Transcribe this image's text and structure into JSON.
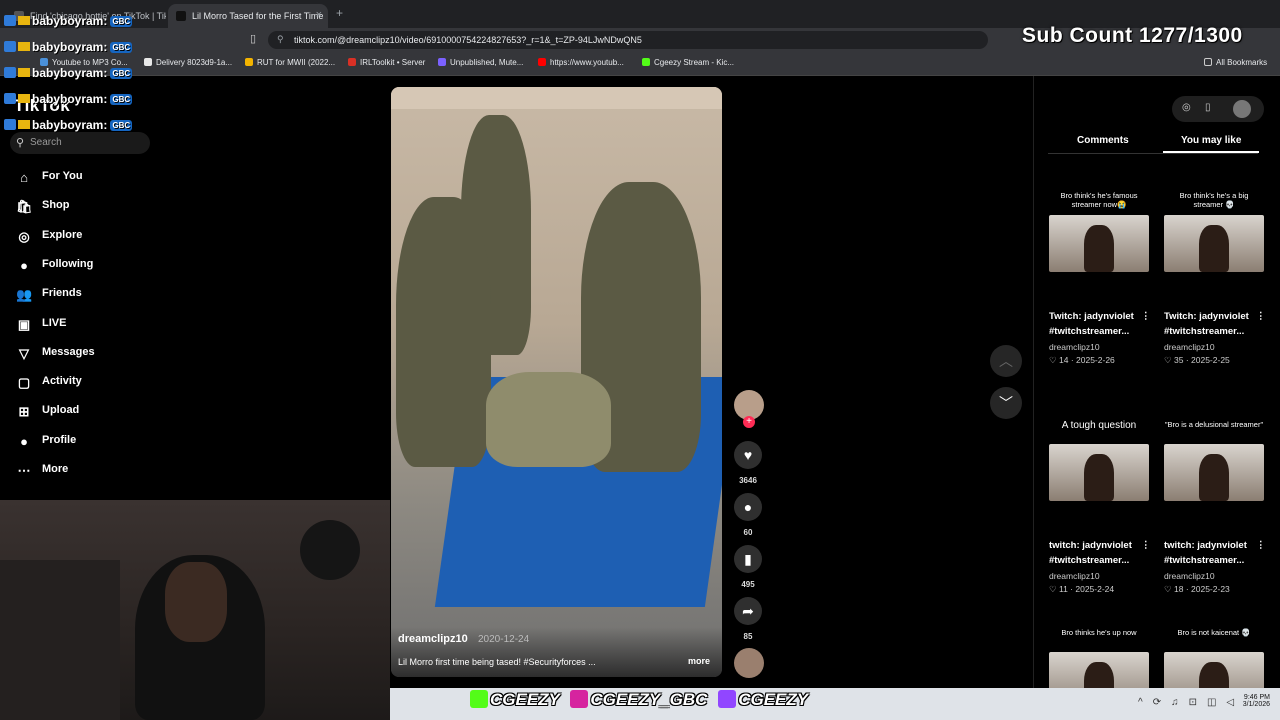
{
  "browser": {
    "tabs": [
      {
        "label": "Find 'chicago hottie' on TikTok | TikTo",
        "active": false
      },
      {
        "label": "Lil Morro Tased for the First Time",
        "active": true
      }
    ],
    "url": "tiktok.com/@dreamclipz10/video/6910000754224827653?_r=1&_t=ZP-94LJwNDwQN5",
    "bookmarks": [
      {
        "label": "Youtube to MP3 Co...",
        "color": "#4a90d9"
      },
      {
        "label": "Delivery 8023d9-1a...",
        "color": "#e8e8e8"
      },
      {
        "label": "RUT for MWII (2022...",
        "color": "#f4b400"
      },
      {
        "label": "IRLToolkit • Server",
        "color": "#d93025"
      },
      {
        "label": "Unpublished, Mute...",
        "color": "#7b61ff"
      },
      {
        "label": "https://www.youtub...",
        "color": "#ff0000"
      },
      {
        "label": "Cgeezy Stream - Kic...",
        "color": "#53fc18"
      }
    ],
    "all_bookmarks": "All Bookmarks"
  },
  "overlay": {
    "sub_count": "Sub Count 1277/1300",
    "chat": [
      {
        "user": "babyboyram:",
        "badge": "GBC"
      },
      {
        "user": "babyboyram:",
        "badge": "GBC"
      },
      {
        "user": "babyboyram:",
        "badge": "GBC"
      },
      {
        "user": "babyboyram:",
        "badge": "GBC"
      },
      {
        "user": "babyboyram:",
        "badge": "GBC"
      }
    ]
  },
  "tiktok": {
    "logo": "TikTok",
    "search_placeholder": "Search",
    "nav": [
      {
        "label": "For You",
        "icon": "home-icon",
        "glyph": "⌂"
      },
      {
        "label": "Shop",
        "icon": "shop-icon",
        "glyph": "🛍"
      },
      {
        "label": "Explore",
        "icon": "compass-icon",
        "glyph": "◎"
      },
      {
        "label": "Following",
        "icon": "avatar-icon",
        "glyph": "●"
      },
      {
        "label": "Friends",
        "icon": "friends-icon",
        "glyph": "👥"
      },
      {
        "label": "LIVE",
        "icon": "live-icon",
        "glyph": "▣"
      },
      {
        "label": "Messages",
        "icon": "send-icon",
        "glyph": "▽"
      },
      {
        "label": "Activity",
        "icon": "activity-icon",
        "glyph": "▢"
      },
      {
        "label": "Upload",
        "icon": "upload-icon",
        "glyph": "⊞"
      },
      {
        "label": "Profile",
        "icon": "avatar-icon",
        "glyph": "●"
      },
      {
        "label": "More",
        "icon": "more-icon",
        "glyph": "⋯"
      }
    ],
    "video": {
      "author": "dreamclipz10",
      "date": "2020-12-24",
      "description": "Lil Morro first time being tased! #Securityforces ...",
      "more": "more"
    },
    "actions": {
      "likes": "3646",
      "comments": "60",
      "saves": "495",
      "shares": "85"
    },
    "right_panel": {
      "tabs": [
        "Comments",
        "You may like"
      ],
      "active_tab": "You may like",
      "cards": [
        {
          "caption": "Bro think's he's famous streamer now😭",
          "title1": "Twitch: jadynviolet",
          "title2": "#twitchstreamer...",
          "author": "dreamclipz10",
          "likes": "14",
          "date": "2025-2-26"
        },
        {
          "caption": "Bro think's he's a big streamer 💀",
          "title1": "Twitch: jadynviolet",
          "title2": "#twitchstreamer...",
          "author": "dreamclipz10",
          "likes": "35",
          "date": "2025-2-25"
        },
        {
          "caption": "A tough question",
          "title1": "twitch: jadynviolet",
          "title2": "#twitchstreamer...",
          "author": "dreamclipz10",
          "likes": "11",
          "date": "2025-2-24"
        },
        {
          "caption": "\"Bro is a delusional streamer\"",
          "title1": "twitch: jadynviolet",
          "title2": "#twitchstreamer...",
          "author": "dreamclipz10",
          "likes": "18",
          "date": "2025-2-23"
        },
        {
          "caption": "Bro thinks he's up now"
        },
        {
          "caption": "Bro is not kaicenat 💀"
        }
      ]
    }
  },
  "taskbar": {
    "socials": [
      "CGEEZY",
      "CGEEZY_GBC",
      "CGEEZY"
    ],
    "time": "9:46 PM",
    "date": "3/1/2026"
  }
}
